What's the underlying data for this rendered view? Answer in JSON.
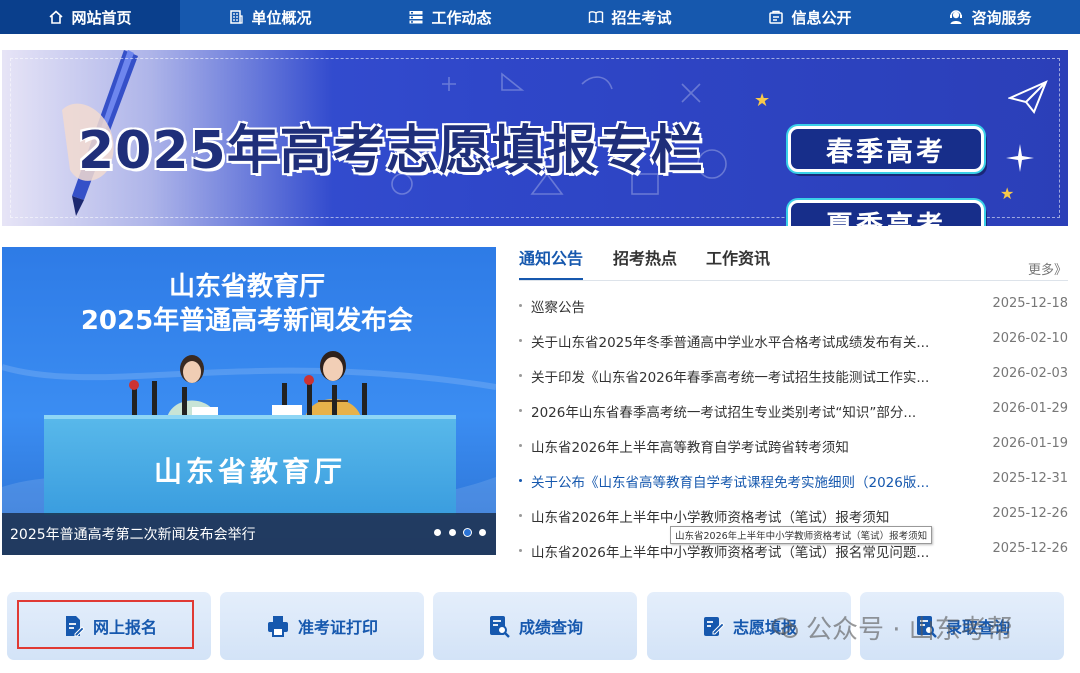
{
  "nav": {
    "items": [
      {
        "label": "网站首页",
        "icon": "home-icon"
      },
      {
        "label": "单位概况",
        "icon": "building-icon"
      },
      {
        "label": "工作动态",
        "icon": "list-icon"
      },
      {
        "label": "招生考试",
        "icon": "book-icon"
      },
      {
        "label": "信息公开",
        "icon": "info-icon"
      },
      {
        "label": "咨询服务",
        "icon": "headset-icon"
      }
    ],
    "active_color": "#0a3f8c",
    "bar_color": "#1658ae"
  },
  "banner": {
    "title": "2025年高考志愿填报专栏",
    "buttons": [
      "春季高考",
      "夏季高考"
    ]
  },
  "photo": {
    "heading_line1": "山东省教育厅",
    "heading_line2": "2025年普通高考新闻发布会",
    "desk_text": "山东省教育厅",
    "caption": "2025年普通高考第二次新闻发布会举行",
    "slide_count": 4,
    "active_slide": 3
  },
  "news": {
    "tabs": [
      "通知公告",
      "招考热点",
      "工作资讯"
    ],
    "more_label": "更多》",
    "items": [
      {
        "title": "巡察公告",
        "date": "2025-12-18"
      },
      {
        "title": "关于山东省2025年冬季普通高中学业水平合格考试成绩发布有关...",
        "date": "2026-02-10"
      },
      {
        "title": "关于印发《山东省2026年春季高考统一考试招生技能测试工作实...",
        "date": "2026-02-03"
      },
      {
        "title": "2026年山东省春季高考统一考试招生专业类别考试“知识”部分...",
        "date": "2026-01-29"
      },
      {
        "title": "山东省2026年上半年高等教育自学考试跨省转考须知",
        "date": "2026-01-19"
      },
      {
        "title": "关于公布《山东省高等教育自学考试课程免考实施细则（2026版...",
        "date": "2025-12-31"
      },
      {
        "title": "山东省2026年上半年中小学教师资格考试（笔试）报考须知",
        "date": "2025-12-26"
      },
      {
        "title": "山东省2026年上半年中小学教师资格考试（笔试）报名常见问题...",
        "date": "2025-12-26"
      }
    ],
    "tooltip": "山东省2026年上半年中小学教师资格考试（笔试）报考须知",
    "highlight_color": "#1658ae"
  },
  "quick": [
    {
      "label": "网上报名",
      "icon": "register-icon"
    },
    {
      "label": "准考证打印",
      "icon": "printer-icon"
    },
    {
      "label": "成绩查询",
      "icon": "score-search-icon"
    },
    {
      "label": "志愿填报",
      "icon": "form-edit-icon"
    },
    {
      "label": "录取查询",
      "icon": "admission-search-icon"
    }
  ],
  "watermark": "公众号 · 山东考帮",
  "highlight_box_color": "#e03a34"
}
